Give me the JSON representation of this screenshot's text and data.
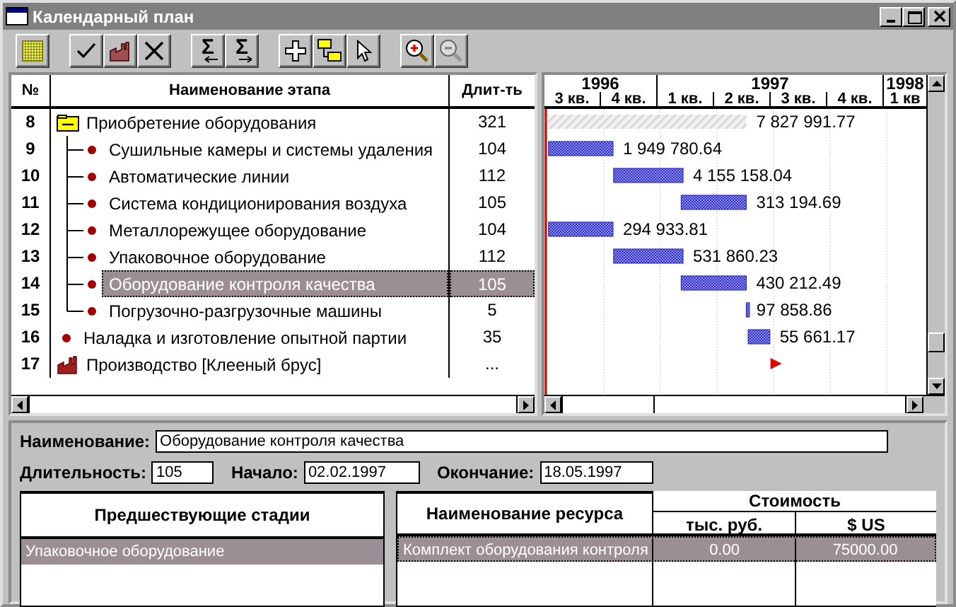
{
  "window": {
    "title": "Календарный план"
  },
  "toolbar": [
    [
      {
        "kind": "grid",
        "disabled": false
      }
    ],
    [
      {
        "kind": "check",
        "disabled": false
      },
      {
        "kind": "factory",
        "disabled": false
      },
      {
        "kind": "cross",
        "disabled": false
      }
    ],
    [
      {
        "kind": "sum-left",
        "glyph": "Σ",
        "disabled": false
      },
      {
        "kind": "sum-right",
        "glyph": "Σ",
        "disabled": false
      }
    ],
    [
      {
        "kind": "plus",
        "disabled": false
      },
      {
        "kind": "tree",
        "disabled": false
      },
      {
        "kind": "pointer",
        "disabled": false
      }
    ],
    [
      {
        "kind": "zoom-in",
        "disabled": false
      },
      {
        "kind": "zoom-out",
        "disabled": true
      }
    ]
  ],
  "grid": {
    "columns": [
      "№",
      "Наименование этапа",
      "Длит-ть"
    ],
    "rows": [
      {
        "number": "8",
        "name": "Приобретение оборудования",
        "duration": "321",
        "kind": "group",
        "expanded": true,
        "selected": false,
        "bar": {
          "kind": "summary",
          "value": "7 827 991.77"
        },
        "children": [
          {
            "number": "9",
            "name": "Сушильные камеры и системы удаления",
            "duration": "104",
            "kind": "task",
            "selected": false,
            "bar": {
              "kind": "task",
              "value": "1 949 780.64"
            }
          },
          {
            "number": "10",
            "name": "Автоматические линии",
            "duration": "112",
            "kind": "task",
            "selected": false,
            "bar": {
              "kind": "task",
              "value": "4 155 158.04"
            }
          },
          {
            "number": "11",
            "name": "Система кондиционирования воздуха",
            "duration": "105",
            "kind": "task",
            "selected": false,
            "bar": {
              "kind": "task",
              "value": "313 194.69"
            }
          },
          {
            "number": "12",
            "name": "Металлорежущее оборудование",
            "duration": "104",
            "kind": "task",
            "selected": false,
            "bar": {
              "kind": "task",
              "value": "294 933.81"
            }
          },
          {
            "number": "13",
            "name": "Упаковочное оборудование",
            "duration": "112",
            "kind": "task",
            "selected": false,
            "bar": {
              "kind": "task",
              "value": "531 860.23"
            }
          },
          {
            "number": "14",
            "name": "Оборудование контроля качества",
            "duration": "105",
            "kind": "task",
            "selected": true,
            "bar": {
              "kind": "task",
              "value": "430 212.49"
            }
          },
          {
            "number": "15",
            "name": "Погрузочно-разгрузочные машины",
            "duration": "5",
            "kind": "task",
            "selected": false,
            "bar": {
              "kind": "task",
              "value": "97 858.86"
            }
          }
        ]
      },
      {
        "number": "16",
        "name": "Наладка и изготовление опытной партии",
        "duration": "35",
        "kind": "task",
        "selected": false,
        "bar": {
          "kind": "task",
          "value": "55 661.17"
        }
      },
      {
        "number": "17",
        "name": "Производство [Клееный брус]",
        "duration": "...",
        "kind": "production",
        "selected": false,
        "bar": {
          "kind": "milestone"
        }
      }
    ]
  },
  "timeline": {
    "years": [
      {
        "label": "1996",
        "quarters": [
          "3 кв.",
          "4 кв."
        ]
      },
      {
        "label": "1997",
        "quarters": [
          "1 кв.",
          "2 кв.",
          "3 кв.",
          "4 кв."
        ]
      },
      {
        "label": "1998",
        "quarters": [
          "1 кв"
        ]
      }
    ]
  },
  "details": {
    "name_label": "Наименование:",
    "name": "Оборудование контроля качества",
    "duration_label": "Длительность:",
    "duration": "105",
    "start_label": "Начало:",
    "start": "02.02.1997",
    "end_label": "Окончание:",
    "end": "18.05.1997"
  },
  "predecessors": {
    "column": "Предшествующие стадии",
    "rows": [
      {
        "name": "Упаковочное оборудование",
        "selected": true
      }
    ]
  },
  "resources": {
    "name_column": "Наименование ресурса",
    "cost_column": "Стоимость",
    "rub_column": "тыс. руб.",
    "usd_column": "$ US",
    "rows": [
      {
        "name": "Комплект оборудования контроля",
        "rub": "0.00",
        "usd": "75000.00",
        "selected": true
      }
    ]
  }
}
